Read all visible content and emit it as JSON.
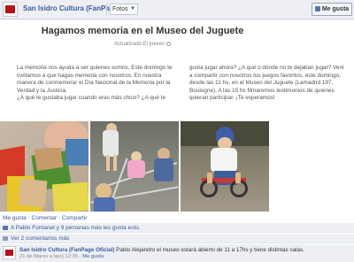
{
  "topbar": {
    "page_name": "San Isidro Cultura (FanPag...",
    "album": "Fotos",
    "like_button": "Me gusta"
  },
  "note": {
    "title": "Hagamos memoria en el Museo del Juguete",
    "updated": "Actualizado El jueves",
    "left_column": [
      "La memoria nos ayuda a ser quienes somos. Este domingo te",
      "invitamos a que hagas memoria con nosotros. En nuestra",
      "manera de conmemorar el Día Nacional de la Memoria por la",
      "Verdad y la Justicia.",
      "¿A qué te gustaba jugar cuando eras más chico? ¿A qué te"
    ],
    "right_column": [
      "gusta jugar ahora? ¿A qué o dónde no te dejaban jugar? Vení",
      "a compartir con nosotros tus juegos favoritos, este domingo,",
      "desde las 11 hs, en el Museo del Juguete (Lamadrid 197,",
      "Boulogne). A las 15 hs filmaremos testimonios de quienes",
      "quieran participar. ¡Te esperamos!"
    ]
  },
  "actions": {
    "like": "Me gusta",
    "comment": "Comentar",
    "share": "Compartir",
    "dot": "·"
  },
  "likes": {
    "text": "A Pablo Fontanet y 9 personas más les gusta esto."
  },
  "comments": {
    "view": "Ver 2 comentarios más"
  },
  "comment": {
    "author": "San Isidro Cultura (FanPage Oficial)",
    "text": "Pablo Alejandro el museo estará abierto de 11 a 17hs y tiene distintas salas.",
    "time": "21 de Marzo a la(s) 12:35",
    "like": "Me gusta"
  }
}
